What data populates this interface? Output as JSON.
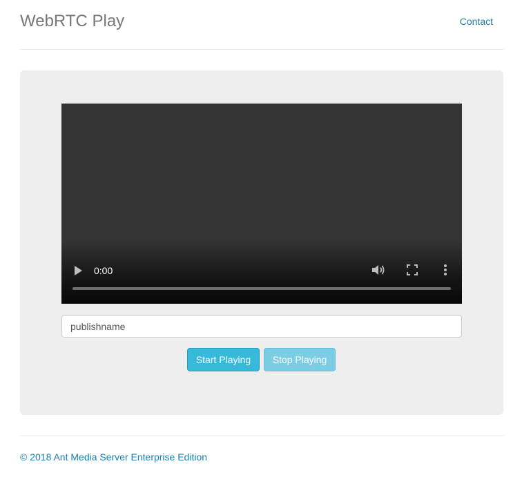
{
  "header": {
    "title": "WebRTC Play",
    "nav_contact": "Contact"
  },
  "player": {
    "time": "0:00",
    "progress_fraction": 0,
    "icons": [
      "play-icon",
      "volume-icon",
      "fullscreen-icon",
      "more-options-icon"
    ]
  },
  "stream_input": {
    "value": "publishname"
  },
  "buttons": {
    "start_label": "Start Playing",
    "stop_label": "Stop Playing"
  },
  "footer": {
    "text": "© 2018 Ant Media Server Enterprise Edition"
  },
  "colors": {
    "link": "#1a7fb0",
    "start_button": "#37b9d9",
    "stop_button_disabled": "#7ccde3",
    "jumbotron_bg": "#eeeeee",
    "video_bg": "#343434"
  }
}
